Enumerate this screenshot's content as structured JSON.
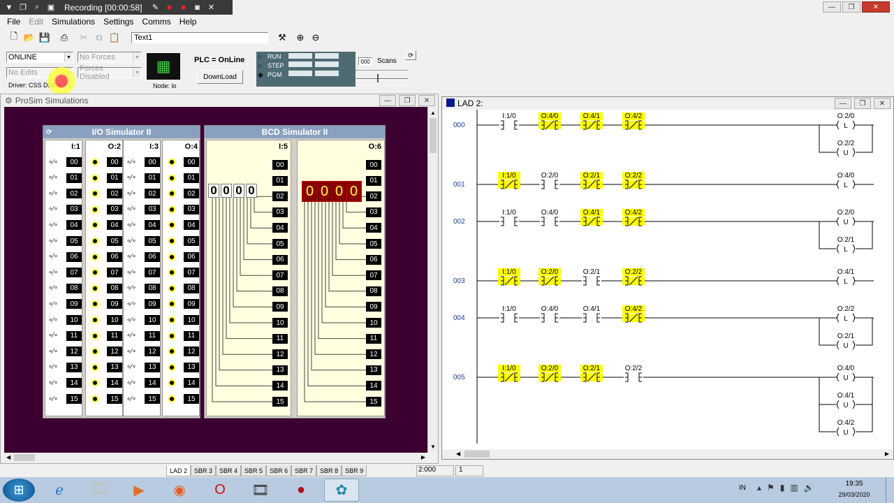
{
  "recorder": {
    "title": "Recording [00:00:58]"
  },
  "menu": [
    "File",
    "Edit",
    "Simulations",
    "Settings",
    "Comms",
    "Help"
  ],
  "toolbar": {
    "text_field": "Text1"
  },
  "status": {
    "mode": "ONLINE",
    "forces": "No Forces",
    "edits": "No Edits",
    "forces_enabled": "Forces Disabled",
    "driver": "Driver: CSS DDE-L",
    "node": "Node: lo",
    "plc_label": "PLC = OnLine",
    "download": "DownLoad",
    "run": "RUN",
    "step": "STEP",
    "pgm": "PGM",
    "scans_value": "000",
    "scans_label": "Scans"
  },
  "prosim": {
    "title": "ProSim Simulations",
    "io_title": "I/O Simulator II",
    "bcd_title": "BCD Simulator II",
    "io_cols": [
      "I:1",
      "O:2",
      "I:3",
      "O:4"
    ],
    "bits": [
      "00",
      "01",
      "02",
      "03",
      "04",
      "05",
      "06",
      "07",
      "08",
      "09",
      "10",
      "11",
      "12",
      "13",
      "14",
      "15"
    ],
    "bcd_in_label": "I:5",
    "bcd_out_label": "O:6",
    "bcd_in_digits": [
      "0",
      "0",
      "0",
      "0"
    ],
    "bcd_out_digits": [
      "0",
      "0",
      "0",
      "0"
    ]
  },
  "ladder": {
    "title": "LAD 2:",
    "rungs": [
      {
        "num": "000",
        "contacts": [
          {
            "t": "I:1/0",
            "hl": false,
            "nc": false
          },
          {
            "t": "O:4/0",
            "hl": true,
            "nc": true
          },
          {
            "t": "O:4/1",
            "hl": true,
            "nc": true
          },
          {
            "t": "O:4/2",
            "hl": true,
            "nc": true
          }
        ],
        "coils": [
          {
            "t": "O:2/0",
            "k": "L"
          },
          {
            "t": "O:2/2",
            "k": "U"
          }
        ]
      },
      {
        "num": "001",
        "contacts": [
          {
            "t": "I:1/0",
            "hl": true,
            "nc": true
          },
          {
            "t": "O:2/0",
            "hl": false,
            "nc": false
          },
          {
            "t": "O:2/1",
            "hl": true,
            "nc": true
          },
          {
            "t": "O:2/2",
            "hl": true,
            "nc": true
          }
        ],
        "coils": [
          {
            "t": "O:4/0",
            "k": "L"
          }
        ]
      },
      {
        "num": "002",
        "contacts": [
          {
            "t": "I:1/0",
            "hl": false,
            "nc": false
          },
          {
            "t": "O:4/0",
            "hl": false,
            "nc": false
          },
          {
            "t": "O:4/1",
            "hl": true,
            "nc": true
          },
          {
            "t": "O:4/2",
            "hl": true,
            "nc": true
          }
        ],
        "coils": [
          {
            "t": "O:2/0",
            "k": "U"
          },
          {
            "t": "O:2/1",
            "k": "L"
          }
        ]
      },
      {
        "num": "003",
        "contacts": [
          {
            "t": "I:1/0",
            "hl": true,
            "nc": true
          },
          {
            "t": "O:2/0",
            "hl": true,
            "nc": true
          },
          {
            "t": "O:2/1",
            "hl": false,
            "nc": false
          },
          {
            "t": "O:2/2",
            "hl": true,
            "nc": true
          }
        ],
        "coils": [
          {
            "t": "O:4/1",
            "k": "L"
          }
        ]
      },
      {
        "num": "004",
        "contacts": [
          {
            "t": "I:1/0",
            "hl": false,
            "nc": false
          },
          {
            "t": "O:4/0",
            "hl": false,
            "nc": false
          },
          {
            "t": "O:4/1",
            "hl": false,
            "nc": false
          },
          {
            "t": "O:4/2",
            "hl": true,
            "nc": true
          }
        ],
        "coils": [
          {
            "t": "O:2/2",
            "k": "L"
          },
          {
            "t": "O:2/1",
            "k": "U"
          }
        ]
      },
      {
        "num": "005",
        "contacts": [
          {
            "t": "I:1/0",
            "hl": true,
            "nc": true
          },
          {
            "t": "O:2/0",
            "hl": true,
            "nc": true
          },
          {
            "t": "O:2/1",
            "hl": true,
            "nc": true
          },
          {
            "t": "O:2/2",
            "hl": false,
            "nc": false
          }
        ],
        "coils": [
          {
            "t": "O:4/0",
            "k": "U"
          },
          {
            "t": "O:4/1",
            "k": "U"
          },
          {
            "t": "O:4/2",
            "k": "U"
          }
        ]
      }
    ]
  },
  "tabs": [
    "LAD 2",
    "SBR 3",
    "SBR 4",
    "SBR 5",
    "SBR 6",
    "SBR 7",
    "SBR 8",
    "SBR 9"
  ],
  "statusbar": {
    "pos": "2:000",
    "col": "1"
  },
  "tray": {
    "lang": "IN",
    "time": "19:35",
    "date": "29/03/2020"
  },
  "colors": {
    "highlight": "#ffff00",
    "sim_bg": "#3c0030"
  }
}
